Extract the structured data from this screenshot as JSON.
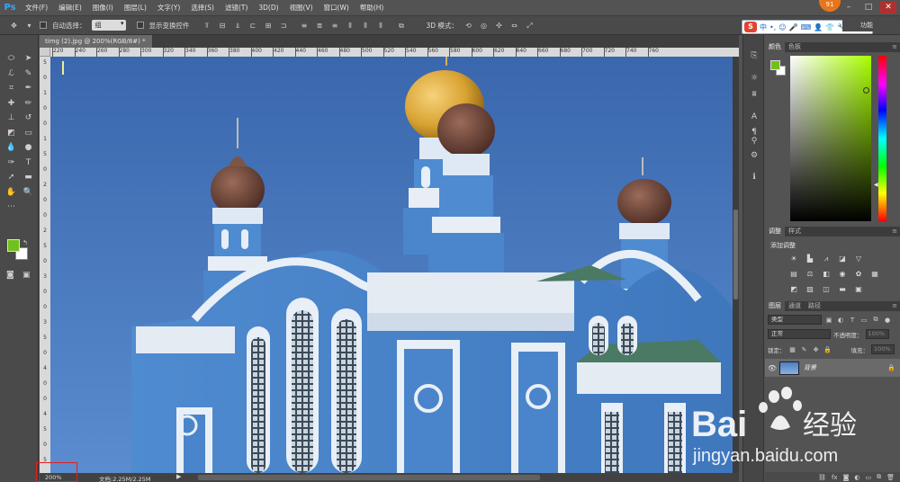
{
  "app": {
    "logo": "Ps",
    "notification_count": "91"
  },
  "menu": [
    "文件(F)",
    "编辑(E)",
    "图像(I)",
    "图层(L)",
    "文字(Y)",
    "选择(S)",
    "滤镜(T)",
    "3D(D)",
    "视图(V)",
    "窗口(W)",
    "帮助(H)"
  ],
  "options": {
    "auto_select_label": "自动选择：",
    "auto_select_value": "组",
    "transform_label": "显示变换控件",
    "mode3d_label": "3D 模式：",
    "workspace_label": "功能"
  },
  "ime": {
    "logo": "S",
    "mode": "中"
  },
  "document": {
    "tab_title": "timg (2).jpg @ 200%(RGB/8#) *",
    "close": "×"
  },
  "ruler_h": [
    "220",
    "240",
    "260",
    "280",
    "300",
    "320",
    "340",
    "360",
    "380",
    "400",
    "420",
    "440",
    "460",
    "480",
    "500",
    "520",
    "540",
    "560",
    "580",
    "600",
    "620",
    "640",
    "660",
    "680",
    "700",
    "720",
    "740",
    "760"
  ],
  "ruler_v": [
    "5",
    "0",
    "1",
    "0",
    "0",
    "1",
    "5",
    "0",
    "2",
    "0",
    "0",
    "2",
    "5",
    "0",
    "3",
    "0",
    "0",
    "3",
    "5",
    "0",
    "4",
    "0",
    "0",
    "4",
    "5",
    "0",
    "5"
  ],
  "status": {
    "zoom": "200%",
    "doc_info": "文档:2.25M/2.25M",
    "arrow": "▶"
  },
  "colors": {
    "foreground": "#72c01d",
    "background": "#ffffff",
    "accent": "#e02020"
  },
  "panels": {
    "color_tabs": [
      "颜色",
      "色板"
    ],
    "adjust_tabs": [
      "调整",
      "样式"
    ],
    "adjust_title": "添加调整",
    "layers_tabs": [
      "图层",
      "通道",
      "路径"
    ],
    "filter_type": "类型",
    "blend_mode": "正常",
    "opacity_label": "不透明度：",
    "opacity_value": "100%",
    "lock_label": "锁定：",
    "fill_label": "填充：",
    "fill_value": "100%",
    "layer_name": "背景"
  },
  "watermark": {
    "brand": "Bai",
    "brand2": "经验",
    "url": "jingyan.baidu.com"
  }
}
